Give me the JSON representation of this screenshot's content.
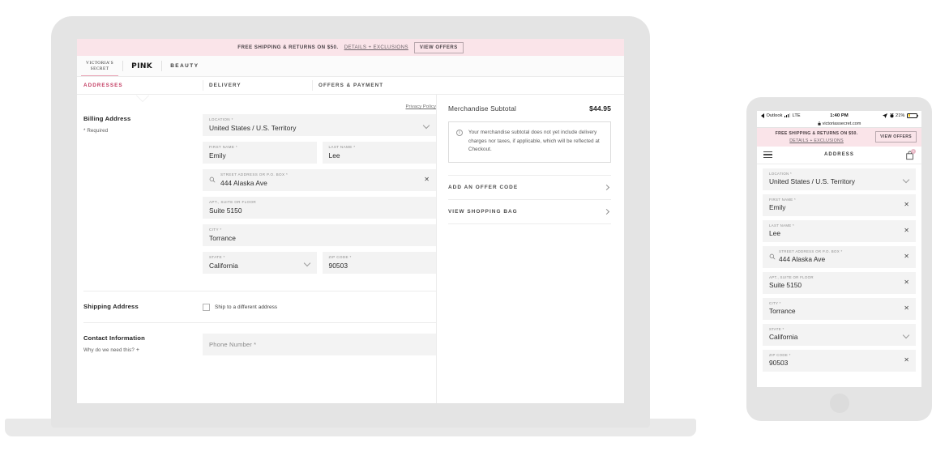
{
  "desktop": {
    "promo": {
      "text": "FREE SHIPPING & RETURNS ON $50.",
      "link": "DETAILS + EXCLUSIONS",
      "button": "VIEW OFFERS"
    },
    "brand_tabs": [
      {
        "label": "VICTORIA'S SECRET",
        "line1": "VICTORIA'S",
        "line2": "SECRET",
        "active": true
      },
      {
        "label": "PINK",
        "active": false
      },
      {
        "label": "BEAUTY",
        "active": false
      }
    ],
    "checkout_steps": [
      {
        "label": "ADDRESSES",
        "current": true
      },
      {
        "label": "DELIVERY",
        "current": false
      },
      {
        "label": "OFFERS & PAYMENT",
        "current": false
      }
    ],
    "billing": {
      "title": "Billing Address",
      "required_note": "* Required",
      "privacy_link": "Privacy Policy",
      "fields": {
        "location": {
          "label": "LOCATION *",
          "value": "United States / U.S. Territory"
        },
        "first_name": {
          "label": "FIRST NAME *",
          "value": "Emily"
        },
        "last_name": {
          "label": "LAST NAME *",
          "value": "Lee"
        },
        "street": {
          "label": "STREET ADDRESS OR P.O. BOX *",
          "value": "444 Alaska Ave"
        },
        "apt": {
          "label": "APT., SUITE OR FLOOR",
          "value": "Suite 5150"
        },
        "city": {
          "label": "CITY *",
          "value": "Torrance"
        },
        "state": {
          "label": "STATE *",
          "value": "California"
        },
        "zip": {
          "label": "ZIP CODE *",
          "value": "90503"
        }
      }
    },
    "shipping": {
      "title": "Shipping Address",
      "checkbox_label": "Ship to a different address"
    },
    "contact": {
      "title": "Contact Information",
      "help_text": "Why do we need this?",
      "phone_placeholder": "Phone Number *"
    },
    "sidebar": {
      "subtotal_label": "Merchandise Subtotal",
      "subtotal_amount": "$44.95",
      "note": "Your merchandise subtotal does not yet include delivery charges nor taxes, if applicable, which will be reflected at Checkout.",
      "rows": [
        {
          "label": "ADD AN OFFER CODE"
        },
        {
          "label": "VIEW SHOPPING BAG"
        }
      ]
    }
  },
  "mobile": {
    "status": {
      "back_app": "Outlook",
      "carrier": "LTE",
      "time": "1:40 PM",
      "battery": "21%"
    },
    "url": "victoriassecret.com",
    "promo": {
      "text": "FREE SHIPPING & RETURNS ON $50.",
      "link": "DETAILS + EXCLUSIONS",
      "button": "VIEW OFFERS"
    },
    "header": {
      "title": "ADDRESS",
      "bag_count": "1"
    },
    "fields": [
      {
        "label": "LOCATION *",
        "value": "United States / U.S. Territory",
        "trailing": "caret",
        "search": false
      },
      {
        "label": "FIRST NAME *",
        "value": "Emily",
        "trailing": "clear",
        "search": false
      },
      {
        "label": "LAST NAME *",
        "value": "Lee",
        "trailing": "clear",
        "search": false
      },
      {
        "label": "STREET ADDRESS OR P.O. BOX *",
        "value": "444 Alaska Ave",
        "trailing": "clear",
        "search": true
      },
      {
        "label": "APT., SUITE OR FLOOR",
        "value": "Suite 5150",
        "trailing": "clear",
        "search": false
      },
      {
        "label": "CITY *",
        "value": "Torrance",
        "trailing": "clear",
        "search": false
      },
      {
        "label": "STATE *",
        "value": "California",
        "trailing": "caret",
        "search": false
      },
      {
        "label": "ZIP CODE *",
        "value": "90503",
        "trailing": "clear",
        "search": false
      }
    ]
  },
  "colors": {
    "brand_pink": "#fae4e9",
    "accent_pink": "#c33c62",
    "field_bg": "#f3f3f3",
    "device_gray": "#e4e4e4"
  }
}
